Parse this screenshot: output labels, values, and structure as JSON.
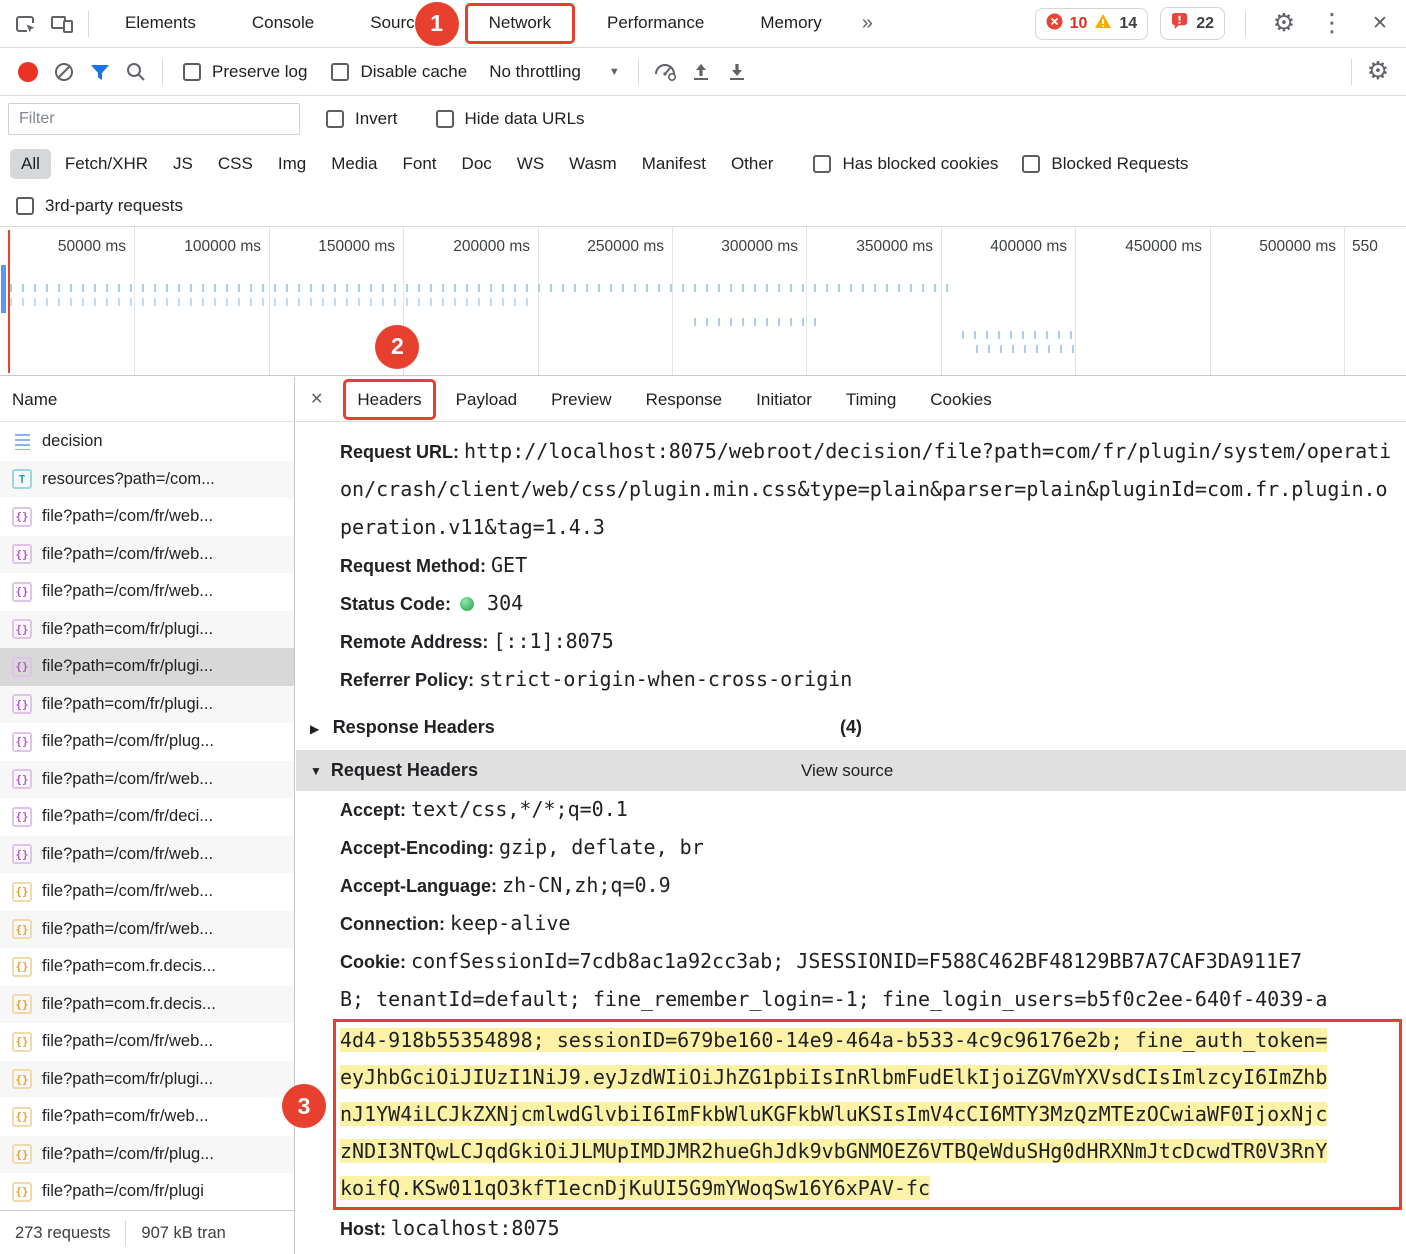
{
  "devtools": {
    "tabs": [
      "Elements",
      "Console",
      "Sources",
      "Network",
      "Performance",
      "Memory"
    ],
    "more_tabs": "»",
    "error_count": "10",
    "warning_count": "14",
    "issues_count": "22"
  },
  "toolbar": {
    "preserve_log": "Preserve log",
    "disable_cache": "Disable cache",
    "throttling": "No throttling"
  },
  "filter": {
    "placeholder": "Filter",
    "invert": "Invert",
    "hide_data_urls": "Hide data URLs",
    "chips": [
      "All",
      "Fetch/XHR",
      "JS",
      "CSS",
      "Img",
      "Media",
      "Font",
      "Doc",
      "WS",
      "Wasm",
      "Manifest",
      "Other"
    ],
    "has_blocked_cookies": "Has blocked cookies",
    "blocked_requests": "Blocked Requests",
    "third_party": "3rd-party requests"
  },
  "timeline": {
    "ticks": [
      "50000 ms",
      "100000 ms",
      "150000 ms",
      "200000 ms",
      "250000 ms",
      "300000 ms",
      "350000 ms",
      "400000 ms",
      "450000 ms",
      "500000 ms",
      "550"
    ]
  },
  "requests": {
    "column_header": "Name",
    "summary": {
      "count": "273 requests",
      "size": "907 kB tran"
    },
    "rows": [
      {
        "label": "decision"
      },
      {
        "label": "resources?path=/com..."
      },
      {
        "label": "file?path=/com/fr/web..."
      },
      {
        "label": "file?path=/com/fr/web..."
      },
      {
        "label": "file?path=/com/fr/web..."
      },
      {
        "label": "file?path=com/fr/plugi..."
      },
      {
        "label": "file?path=com/fr/plugi..."
      },
      {
        "label": "file?path=com/fr/plugi..."
      },
      {
        "label": "file?path=/com/fr/plug..."
      },
      {
        "label": "file?path=/com/fr/web..."
      },
      {
        "label": "file?path=/com/fr/deci..."
      },
      {
        "label": "file?path=/com/fr/web..."
      },
      {
        "label": "file?path=/com/fr/web..."
      },
      {
        "label": "file?path=/com/fr/web..."
      },
      {
        "label": "file?path=com.fr.decis..."
      },
      {
        "label": "file?path=com.fr.decis..."
      },
      {
        "label": "file?path=/com/fr/web..."
      },
      {
        "label": "file?path=com/fr/plugi..."
      },
      {
        "label": "file?path=com/fr/web..."
      },
      {
        "label": "file?path=/com/fr/plug..."
      },
      {
        "label": "file?path=/com/fr/plugi"
      }
    ]
  },
  "details": {
    "tabs": [
      "Headers",
      "Payload",
      "Preview",
      "Response",
      "Initiator",
      "Timing",
      "Cookies"
    ],
    "general": [
      {
        "key": "Request URL:",
        "value": "http://localhost:8075/webroot/decision/file?path=com/fr/plugin/system/operation/crash/client/web/css/plugin.min.css&type=plain&parser=plain&pluginId=com.fr.plugin.operation.v11&tag=1.4.3"
      },
      {
        "key": "Request Method:",
        "value": "GET"
      },
      {
        "key": "Status Code:",
        "value": "304"
      },
      {
        "key": "Remote Address:",
        "value": "[::1]:8075"
      },
      {
        "key": "Referrer Policy:",
        "value": "strict-origin-when-cross-origin"
      }
    ],
    "response_headers": {
      "label": "Response Headers",
      "count": "(4)"
    },
    "request_headers": {
      "label": "Request Headers",
      "view_source": "View source"
    },
    "headers": [
      {
        "key": "Accept:",
        "value": "text/css,*/*;q=0.1"
      },
      {
        "key": "Accept-Encoding:",
        "value": "gzip, deflate, br"
      },
      {
        "key": "Accept-Language:",
        "value": "zh-CN,zh;q=0.9"
      },
      {
        "key": "Connection:",
        "value": "keep-alive"
      }
    ],
    "cookie": {
      "key": "Cookie:",
      "line1": "confSessionId=7cdb8ac1a92cc3ab; JSESSIONID=F588C462BF48129BB7A7CAF3DA911E7",
      "line2": "B; tenantId=default; fine_remember_login=-1; fine_login_users=b5f0c2ee-640f-4039-a",
      "highlight_lines": [
        "4d4-918b55354898; sessionID=679be160-14e9-464a-b533-4c9c96176e2b; fine_auth_token=",
        "eyJhbGciOiJIUzI1NiJ9.eyJzdWIiOiJhZG1pbiIsInRlbmFudElkIjoiZGVmYXVsdCIsImlzcyI6ImZhb",
        "nJ1YW4iLCJkZXNjcmlwdGlvbiI6ImFkbWluKGFkbWluKSIsImV4cCI6MTY3MzQzMTEzOCwiaWF0IjoxNjc",
        "zNDI3NTQwLCJqdGkiOiJLMUpIMDJMR2hueGhJdk9vbGNMOEZ6VTBQeWduSHg0dHRXNmJtcDcwdTR0V3RnY",
        "koifQ.KSw011qO3kfT1ecnDjKuUI5G9mYWoqSw16Y6xPAV-fc"
      ]
    },
    "host": {
      "key": "Host:",
      "value": "localhost:8075"
    }
  },
  "annotations": {
    "step1": "1",
    "step2": "2",
    "step3": "3"
  },
  "icons": {
    "gear": "⚙",
    "kebab": "⋮",
    "close": "✕",
    "close_details": "✕",
    "dropdown": "▼",
    "collapsed": "▶",
    "expanded": "▼",
    "braces": "{}",
    "letter_t": "T"
  },
  "colors": {
    "annotation_red": "#e8402f",
    "highlight_yellow": "#fcf2a6",
    "record_red": "#ea3323",
    "filter_active_blue": "#1a73e8",
    "status_green_304": "#23a047",
    "error_red": "#ea4335",
    "warning_yellow": "#f9ab00",
    "selected_row": "#d8d8d8"
  }
}
